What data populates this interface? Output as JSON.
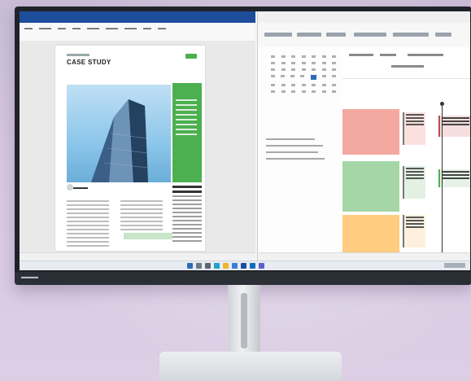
{
  "scene": {
    "background_color": "#d3c6de",
    "monitor_bezel_color": "#1f2329",
    "stand_color": "#e3e5e9"
  },
  "word_doc": {
    "title": "CASE STUDY",
    "accent_color": "#4caf50",
    "titlebar_color": "#1e4d9b"
  },
  "outlook": {
    "event_colors": [
      "#f4a9a0",
      "#a5d6a7",
      "#ffcc80"
    ]
  },
  "taskbar": {
    "icons": [
      "start-icon",
      "search-icon",
      "task-view-icon",
      "edge-icon",
      "explorer-icon",
      "store-icon",
      "word-icon",
      "outlook-icon",
      "teams-icon"
    ]
  }
}
